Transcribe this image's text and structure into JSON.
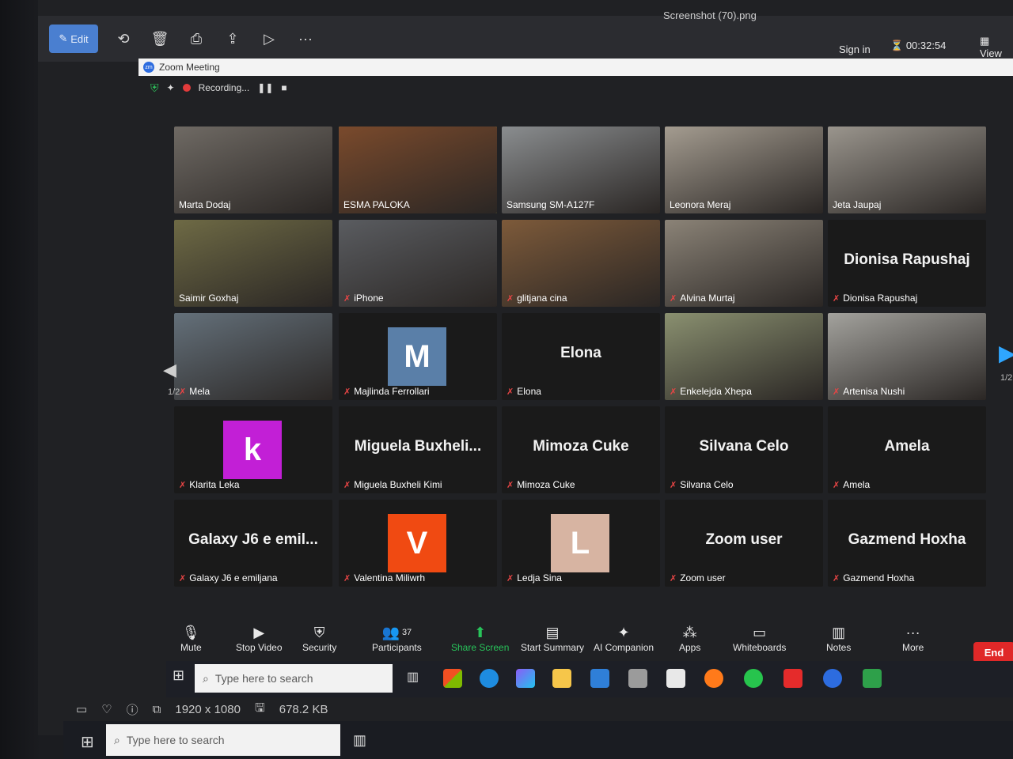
{
  "viewer": {
    "edit_label": "Edit",
    "title": "Screenshot (70).png",
    "dimensions": "1920 x 1080",
    "filesize": "678.2 KB"
  },
  "zoom": {
    "window_title": "Zoom Meeting",
    "sign_in": "Sign in",
    "timer": "00:32:54",
    "view_label": "View",
    "recording_label": "Recording...",
    "page_left": "1/2",
    "page_right": "1/2"
  },
  "participants": [
    {
      "name": "Marta Dodaj",
      "kind": "video",
      "muted": false
    },
    {
      "name": "ESMA PALOKA",
      "kind": "video",
      "muted": false,
      "active": true
    },
    {
      "name": "Samsung SM-A127F",
      "kind": "video",
      "muted": false
    },
    {
      "name": "Leonora Meraj",
      "kind": "video",
      "muted": false
    },
    {
      "name": "Jeta Jaupaj",
      "kind": "video",
      "muted": false
    },
    {
      "name": "Saimir Goxhaj",
      "kind": "video",
      "muted": false
    },
    {
      "name": "iPhone",
      "kind": "video",
      "muted": true
    },
    {
      "name": "glitjana cina",
      "kind": "video",
      "muted": true
    },
    {
      "name": "Alvina Murtaj",
      "kind": "video",
      "muted": true
    },
    {
      "name": "Dionisa Rapushaj",
      "kind": "text",
      "big": "Dionisa Rapushaj",
      "muted": true
    },
    {
      "name": "Mela",
      "kind": "video",
      "muted": true
    },
    {
      "name": "Majlinda Ferrollari",
      "kind": "avatar",
      "letter": "M",
      "color": "#5a7fa8",
      "muted": true
    },
    {
      "name": "Elona",
      "kind": "text",
      "big": "Elona",
      "muted": true
    },
    {
      "name": "Enkelejda Xhepa",
      "kind": "video",
      "muted": true
    },
    {
      "name": "Artenisa Nushi",
      "kind": "video",
      "muted": true
    },
    {
      "name": "Klarita Leka",
      "kind": "avatar",
      "letter": "k",
      "color": "#c21fd6",
      "muted": true
    },
    {
      "name": "Miguela Buxheli Kimi",
      "kind": "text",
      "big": "Miguela  Buxheli...",
      "muted": true
    },
    {
      "name": "Mimoza Cuke",
      "kind": "text",
      "big": "Mimoza Cuke",
      "muted": true
    },
    {
      "name": "Silvana Celo",
      "kind": "text",
      "big": "Silvana Celo",
      "muted": true
    },
    {
      "name": "Amela",
      "kind": "text",
      "big": "Amela",
      "muted": true
    },
    {
      "name": "Galaxy J6 e emiljana",
      "kind": "text",
      "big": "Galaxy J6 e emil...",
      "muted": true
    },
    {
      "name": "Valentina Miliwrh",
      "kind": "avatar",
      "letter": "V",
      "color": "#f04a12",
      "muted": true
    },
    {
      "name": "Ledja Sina",
      "kind": "avatar",
      "letter": "L",
      "color": "#d7b4a2",
      "muted": true
    },
    {
      "name": "Zoom user",
      "kind": "text",
      "big": "Zoom user",
      "muted": true
    },
    {
      "name": "Gazmend Hoxha",
      "kind": "text",
      "big": "Gazmend Hoxha",
      "muted": true
    }
  ],
  "controls": {
    "mute": "Mute",
    "stop_video": "Stop Video",
    "security": "Security",
    "participants_count": "37",
    "participants": "Participants",
    "share_screen": "Share Screen",
    "start_summary": "Start Summary",
    "ai_companion": "AI Companion",
    "apps": "Apps",
    "whiteboards": "Whiteboards",
    "notes": "Notes",
    "more": "More",
    "end": "End"
  },
  "taskbar": {
    "search_placeholder": "Type here to search"
  },
  "colors": {
    "active_speaker": "#d8e04a",
    "muted_mic": "#e84545",
    "share_screen": "#28c35a",
    "end_button": "#e02828"
  }
}
